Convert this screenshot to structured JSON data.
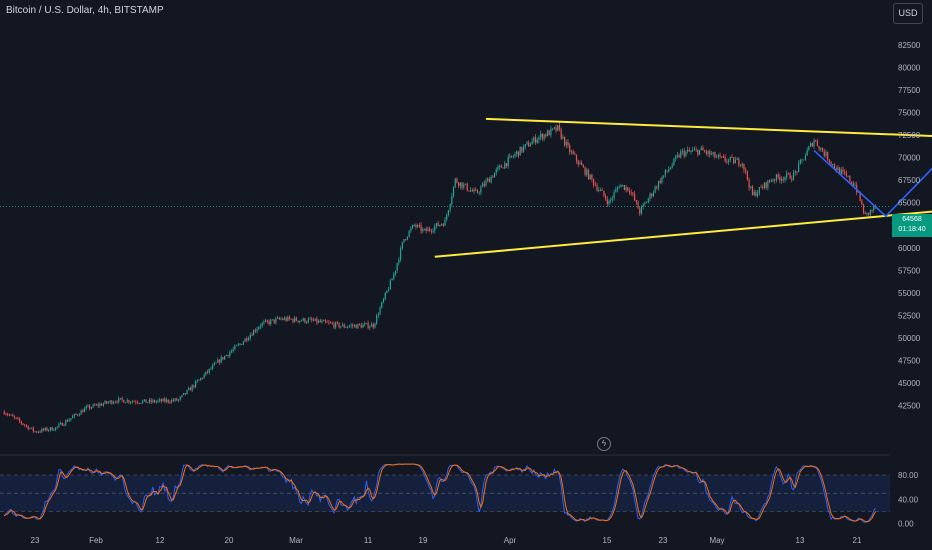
{
  "header": {
    "symbol_title": "Bitcoin / U.S. Dollar, 4h, BITSTAMP",
    "currency_label": "USD"
  },
  "price_badge": {
    "price": "64568",
    "countdown": "01:18:40"
  },
  "icons": {
    "replay": "lightning-icon"
  },
  "colors": {
    "background": "#131722",
    "up": "#26a69a",
    "down": "#ef5350",
    "trendline": "#ffeb3b",
    "projection": "#2962ff",
    "stoch_k": "#2962ff",
    "stoch_d": "#ff6d00",
    "axis_text": "#b2b5be"
  },
  "chart_data": [
    {
      "type": "candlestick",
      "timeframe": "4h",
      "price_axis_ticks": [
        "42500",
        "45000",
        "47500",
        "50000",
        "52500",
        "55000",
        "57500",
        "60000",
        "62500",
        "65000",
        "67500",
        "70000",
        "72500",
        "75000",
        "77500",
        "80000",
        "82500",
        "85000"
      ],
      "time_axis_ticks": [
        "23",
        "Feb",
        "12",
        "20",
        "Mar",
        "11",
        "19",
        "Apr",
        "15",
        "23",
        "May",
        "13",
        "21"
      ],
      "ylim": [
        39000,
        86500
      ],
      "last_price": 64568,
      "price_path": [
        [
          "2024-01-20",
          41800
        ],
        [
          "2024-01-23",
          39600
        ],
        [
          "2024-01-25",
          40000
        ],
        [
          "2024-01-28",
          42200
        ],
        [
          "2024-01-31",
          43100
        ],
        [
          "2024-02-03",
          42900
        ],
        [
          "2024-02-06",
          43100
        ],
        [
          "2024-02-08",
          45300
        ],
        [
          "2024-02-10",
          47500
        ],
        [
          "2024-02-12",
          49300
        ],
        [
          "2024-02-14",
          51500
        ],
        [
          "2024-02-16",
          52100
        ],
        [
          "2024-02-19",
          51900
        ],
        [
          "2024-02-22",
          51300
        ],
        [
          "2024-02-25",
          51400
        ],
        [
          "2024-02-27",
          57000
        ],
        [
          "2024-02-28",
          61000
        ],
        [
          "2024-02-29",
          62500
        ],
        [
          "2024-03-01",
          61800
        ],
        [
          "2024-03-03",
          62900
        ],
        [
          "2024-03-04",
          67500
        ],
        [
          "2024-03-06",
          66000
        ],
        [
          "2024-03-08",
          68500
        ],
        [
          "2024-03-10",
          70500
        ],
        [
          "2024-03-12",
          72200
        ],
        [
          "2024-03-14",
          73200
        ],
        [
          "2024-03-15",
          71000
        ],
        [
          "2024-03-17",
          68000
        ],
        [
          "2024-03-19",
          65000
        ],
        [
          "2024-03-20",
          67000
        ],
        [
          "2024-03-21",
          66500
        ],
        [
          "2024-03-22",
          64000
        ],
        [
          "2024-03-24",
          67500
        ],
        [
          "2024-03-26",
          70500
        ],
        [
          "2024-03-28",
          70800
        ],
        [
          "2024-03-30",
          69800
        ],
        [
          "2024-04-01",
          69500
        ],
        [
          "2024-04-02",
          65800
        ],
        [
          "2024-04-04",
          67700
        ],
        [
          "2024-04-06",
          68000
        ],
        [
          "2024-04-08",
          72000
        ],
        [
          "2024-04-10",
          69000
        ],
        [
          "2024-04-12",
          67000
        ],
        [
          "2024-04-13",
          63500
        ],
        [
          "2024-04-14",
          64568
        ]
      ],
      "annotations": {
        "upper_trendline": [
          [
            "2024-03-07",
            74300
          ],
          [
            "2024-04-29",
            72000
          ]
        ],
        "lower_trendline": [
          [
            "2024-03-02",
            59000
          ],
          [
            "2024-05-01",
            65200
          ]
        ],
        "projection_path": [
          [
            "2024-04-08",
            70800
          ],
          [
            "2024-04-15",
            63500
          ],
          [
            "2024-04-25",
            75200
          ],
          [
            "2024-04-29",
            72000
          ],
          [
            "2024-05-07",
            80500
          ]
        ]
      }
    },
    {
      "type": "line",
      "name": "Stochastic",
      "ylim": [
        -10,
        100
      ],
      "levels": [
        80,
        50,
        20
      ],
      "y_axis_ticks": [
        "80.00",
        "40.00",
        "0.00"
      ]
    }
  ]
}
